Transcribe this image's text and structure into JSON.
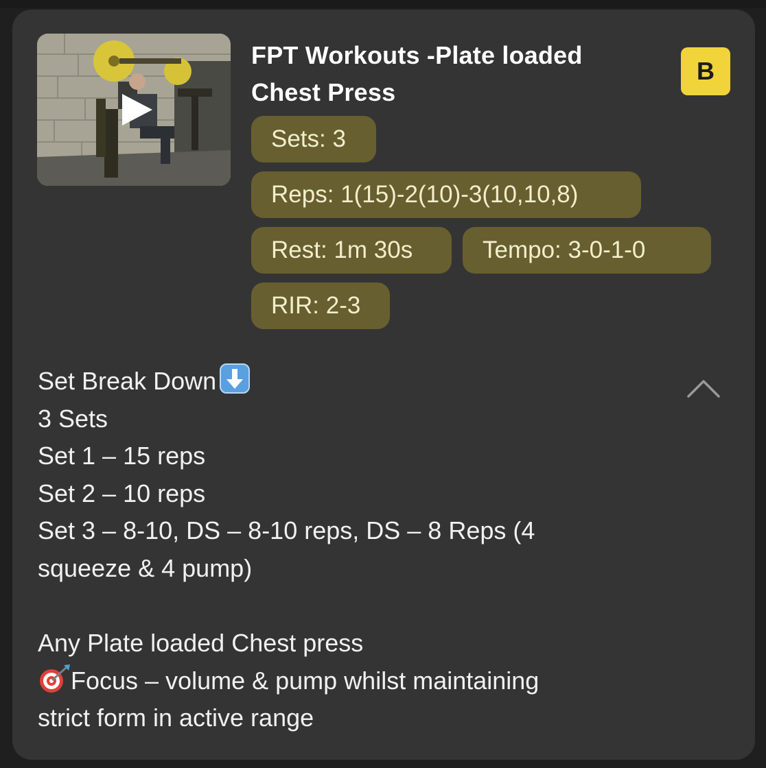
{
  "card": {
    "title": "FPT Workouts -Plate loaded Chest Press",
    "badge": "B",
    "chips": {
      "sets": "Sets: 3",
      "reps": "Reps: 1(15)-2(10)-3(10,10,8)",
      "rest": "Rest: 1m 30s",
      "tempo": "Tempo: 3-0-1-0",
      "rir": "RIR: 2-3"
    },
    "description": {
      "heading": "Set Break Down",
      "lines": [
        "3 Sets",
        "Set 1 – 15 reps",
        "Set 2 – 10 reps",
        "Set 3 – 8-10, DS – 8-10 reps, DS – 8 Reps (4",
        "squeeze & 4 pump)"
      ],
      "note_line": "Any Plate loaded Chest press",
      "focus_line": "Focus – volume & pump whilst maintaining",
      "focus_line_2": "strict form in active range"
    },
    "icons": {
      "thumbnail": "exercise-video-thumbnail",
      "play": "play-icon",
      "heading_emoji": "down-arrow-emoji",
      "focus_emoji": "target-dart-emoji",
      "collapse": "chevron-up-icon"
    },
    "colors": {
      "card_bg": "#343434",
      "chip_bg": "#675f30",
      "chip_text": "#f3eecb",
      "badge_bg": "#f0d43a"
    }
  }
}
